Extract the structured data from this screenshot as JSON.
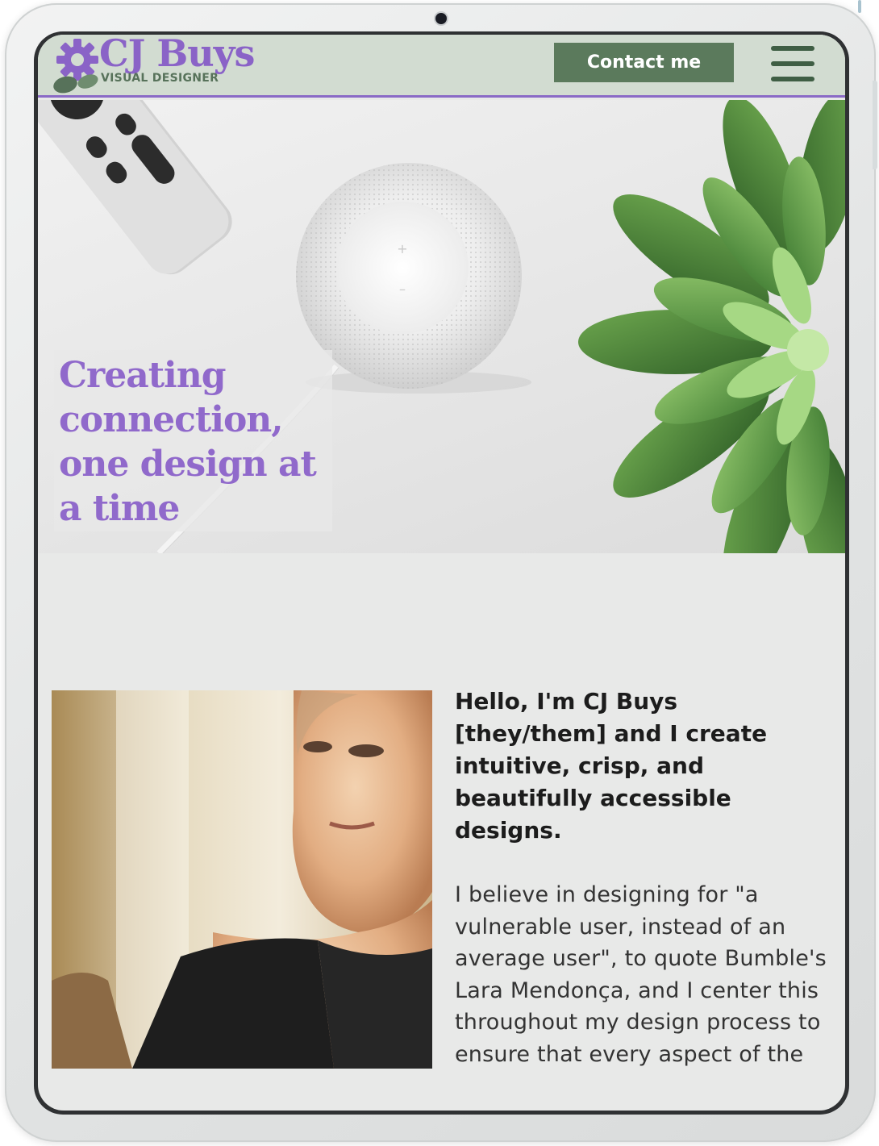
{
  "header": {
    "logo_name": "CJ Buys",
    "logo_subtitle": "VISUAL DESIGNER",
    "contact_label": "Contact me",
    "menu_icon": "hamburger-menu-icon"
  },
  "hero": {
    "tagline": "Creating connection, one design at a time"
  },
  "about": {
    "heading": "Hello, I'm CJ Buys [they/them] and I create intuitive, crisp, and beautifully accessible designs.",
    "body": "I believe in designing for \"a vulnerable user, instead of an average user\", to quote Bumble's Lara Mendonça, and I center this throughout my design process to ensure that every aspect of the"
  },
  "colors": {
    "brand_purple": "#8a63c7",
    "brand_green": "#5b7a5c",
    "header_bg": "#d2dcd1",
    "page_bg": "#e8e9e8"
  }
}
